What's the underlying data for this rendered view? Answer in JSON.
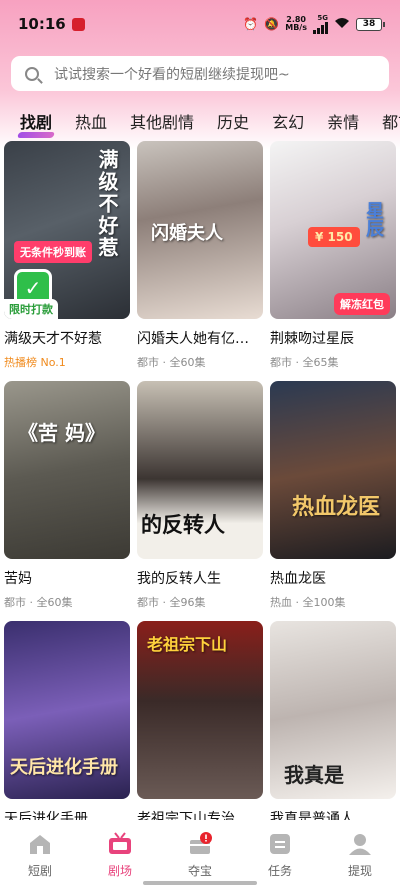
{
  "status_bar": {
    "time": "10:16",
    "speed": "2.80",
    "speed_unit": "MB/s",
    "network": "5G",
    "battery": "38"
  },
  "search": {
    "placeholder": "试试搜索一个好看的短剧继续提现吧~"
  },
  "categories": [
    "找剧",
    "热血",
    "其他剧情",
    "历史",
    "玄幻",
    "亲情",
    "都市"
  ],
  "dramas": [
    {
      "title": "满级天才不好惹",
      "sub": "热播榜 No.1",
      "poster_text": "满级不好惹",
      "badge": "无条件秒到账",
      "badge2": "限时打款"
    },
    {
      "title": "闪婚夫人她有亿点野",
      "sub": "都市 · 全60集",
      "poster_text": "闪婚夫人"
    },
    {
      "title": "荆棘吻过星辰",
      "sub": "都市 · 全65集",
      "poster_text": "星辰",
      "amount": "¥ 150",
      "redpack": "解冻红包"
    },
    {
      "title": "苦妈",
      "sub": "都市 · 全60集",
      "poster_text": "《苦 妈》"
    },
    {
      "title": "我的反转人生",
      "sub": "都市 · 全96集",
      "poster_text": "的反转人"
    },
    {
      "title": "热血龙医",
      "sub": "热血 · 全100集",
      "poster_text": "热血龙医"
    },
    {
      "title": "天后进化手册",
      "sub": "",
      "poster_text": "天后进化手册"
    },
    {
      "title": "老祖宗下山专治各种不服",
      "sub": "",
      "poster_text": "老祖宗下山"
    },
    {
      "title": "我真是普通人",
      "sub": "",
      "poster_text": "我真是"
    }
  ],
  "bottom_nav": [
    {
      "label": "短剧"
    },
    {
      "label": "剧场"
    },
    {
      "label": "夺宝"
    },
    {
      "label": "任务"
    },
    {
      "label": "提现"
    }
  ],
  "colors": {
    "accent": "#e8437c",
    "hot_label": "#f08a1c",
    "top_gradient": "#f7a1c0"
  }
}
